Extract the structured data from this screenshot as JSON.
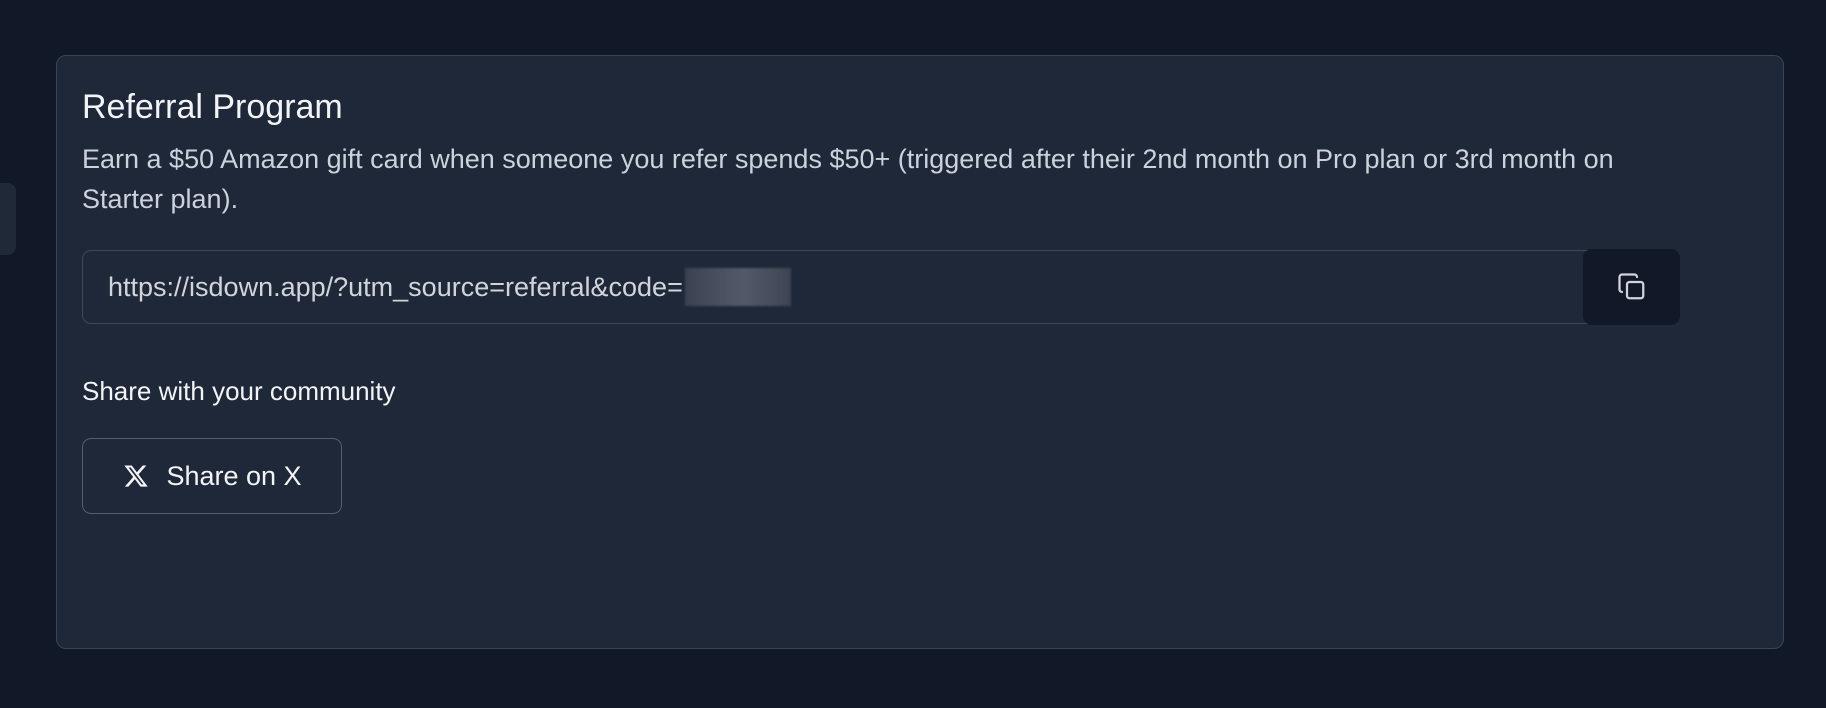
{
  "referral": {
    "title": "Referral Program",
    "description": "Earn a $50 Amazon gift card when someone you refer spends $50+ (triggered after their 2nd month on Pro plan or 3rd month on Starter plan).",
    "url": "https://isdown.app/?utm_source=referral&code="
  },
  "share": {
    "heading": "Share with your community",
    "button_label": "Share on X"
  },
  "icons": {
    "copy": "copy-icon",
    "x_logo": "x-logo-icon"
  }
}
